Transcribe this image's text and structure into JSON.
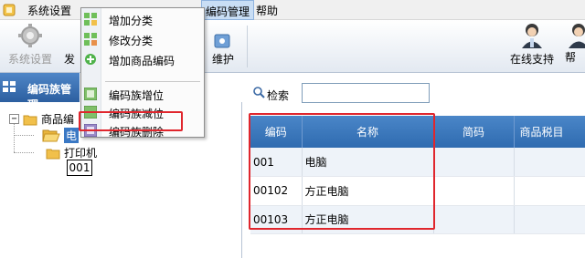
{
  "menubar": {
    "items": [
      {
        "label": "系统设置"
      },
      {
        "label": "编码管理"
      },
      {
        "label": "帮助"
      }
    ]
  },
  "toolbar": {
    "left_buttons": [
      {
        "label": "系统设置",
        "icon": "gear-icon",
        "enabled": false
      },
      {
        "label": "发"
      }
    ],
    "mid_button": {
      "label": "维护"
    },
    "right_buttons": [
      {
        "label": "在线支持",
        "icon": "user-support-icon"
      },
      {
        "label": "帮",
        "icon": "help-user-icon"
      }
    ]
  },
  "left_panel": {
    "header": "编码族管理",
    "tree": {
      "root": "商品编",
      "children": [
        {
          "label": "电"
        },
        {
          "label": "打印机"
        }
      ],
      "tooltip": "001"
    }
  },
  "dropdown": {
    "items": [
      {
        "label": "增加分类",
        "icon": "add-category-icon"
      },
      {
        "label": "修改分类",
        "icon": "edit-category-icon"
      },
      {
        "label": "增加商品编码",
        "icon": "add-code-icon"
      },
      {
        "label": "编码族增位",
        "icon": "increase-digit-icon"
      },
      {
        "label": "编码族减位",
        "icon": "decrease-digit-icon"
      },
      {
        "label": "编码族删除",
        "icon": "delete-family-icon"
      }
    ]
  },
  "search": {
    "label": "检索",
    "value": ""
  },
  "grid": {
    "columns": [
      "编码",
      "名称",
      "简码",
      "商品税目"
    ],
    "rows": [
      [
        "001",
        "电脑",
        "",
        ""
      ],
      [
        "00102",
        "方正电脑",
        "",
        ""
      ],
      [
        "00103",
        "方正电脑",
        "",
        ""
      ]
    ]
  },
  "colors": {
    "header_blue": "#2f6bb0",
    "highlight_red": "#e0262d"
  }
}
